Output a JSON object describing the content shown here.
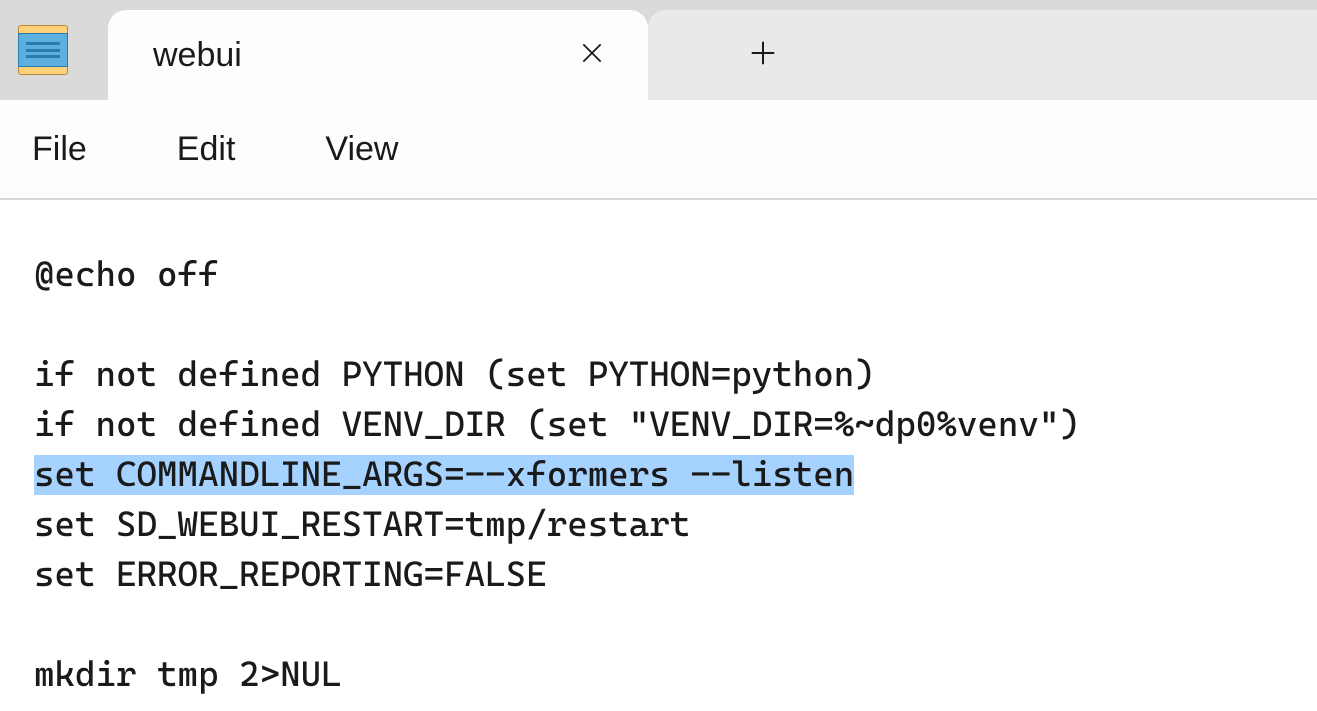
{
  "tab": {
    "title": "webui"
  },
  "menu": {
    "file": "File",
    "edit": "Edit",
    "view": "View"
  },
  "content": {
    "lines": [
      "@echo off",
      "",
      "if not defined PYTHON (set PYTHON=python)",
      "if not defined VENV_DIR (set \"VENV_DIR=%~dp0%venv\")",
      "set COMMANDLINE_ARGS=--xformers --listen",
      "set SD_WEBUI_RESTART=tmp/restart",
      "set ERROR_REPORTING=FALSE",
      "",
      "mkdir tmp 2>NUL"
    ],
    "highlighted_line_index": 4
  }
}
